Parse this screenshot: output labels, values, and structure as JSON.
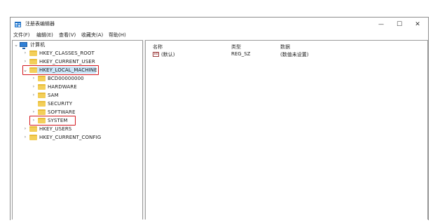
{
  "window": {
    "title": "注册表编辑器",
    "controls": {
      "minimize": "—",
      "maximize": "☐",
      "close": "✕"
    }
  },
  "menu": [
    "文件(F)",
    "编辑(E)",
    "查看(V)",
    "收藏夹(A)",
    "帮助(H)"
  ],
  "tree": {
    "root": "计算机",
    "hives": {
      "classes_root": "HKEY_CLASSES_ROOT",
      "current_user": "HKEY_CURRENT_USER",
      "local_machine": "HKEY_LOCAL_MACHINE",
      "users": "HKEY_USERS",
      "current_config": "HKEY_CURRENT_CONFIG"
    },
    "local_machine_children": [
      "BCD00000000",
      "HARDWARE",
      "SAM",
      "SECURITY",
      "SOFTWARE",
      "SYSTEM"
    ],
    "selected": "HKEY_LOCAL_MACHINE",
    "highlighted": [
      "HKEY_LOCAL_MACHINE",
      "SYSTEM"
    ]
  },
  "list": {
    "columns": {
      "name": "名称",
      "type": "类型",
      "data": "数据"
    },
    "rows": [
      {
        "icon": "string-value-icon",
        "name": "(默认)",
        "type": "REG_SZ",
        "data": "(数值未设置)"
      }
    ]
  },
  "icons": {
    "chevron_expanded": "⌄",
    "chevron_collapsed": "›"
  },
  "colors": {
    "highlight_box": "#d3181f",
    "selection": "#cce4f7",
    "folder": "#f3cf5a"
  }
}
